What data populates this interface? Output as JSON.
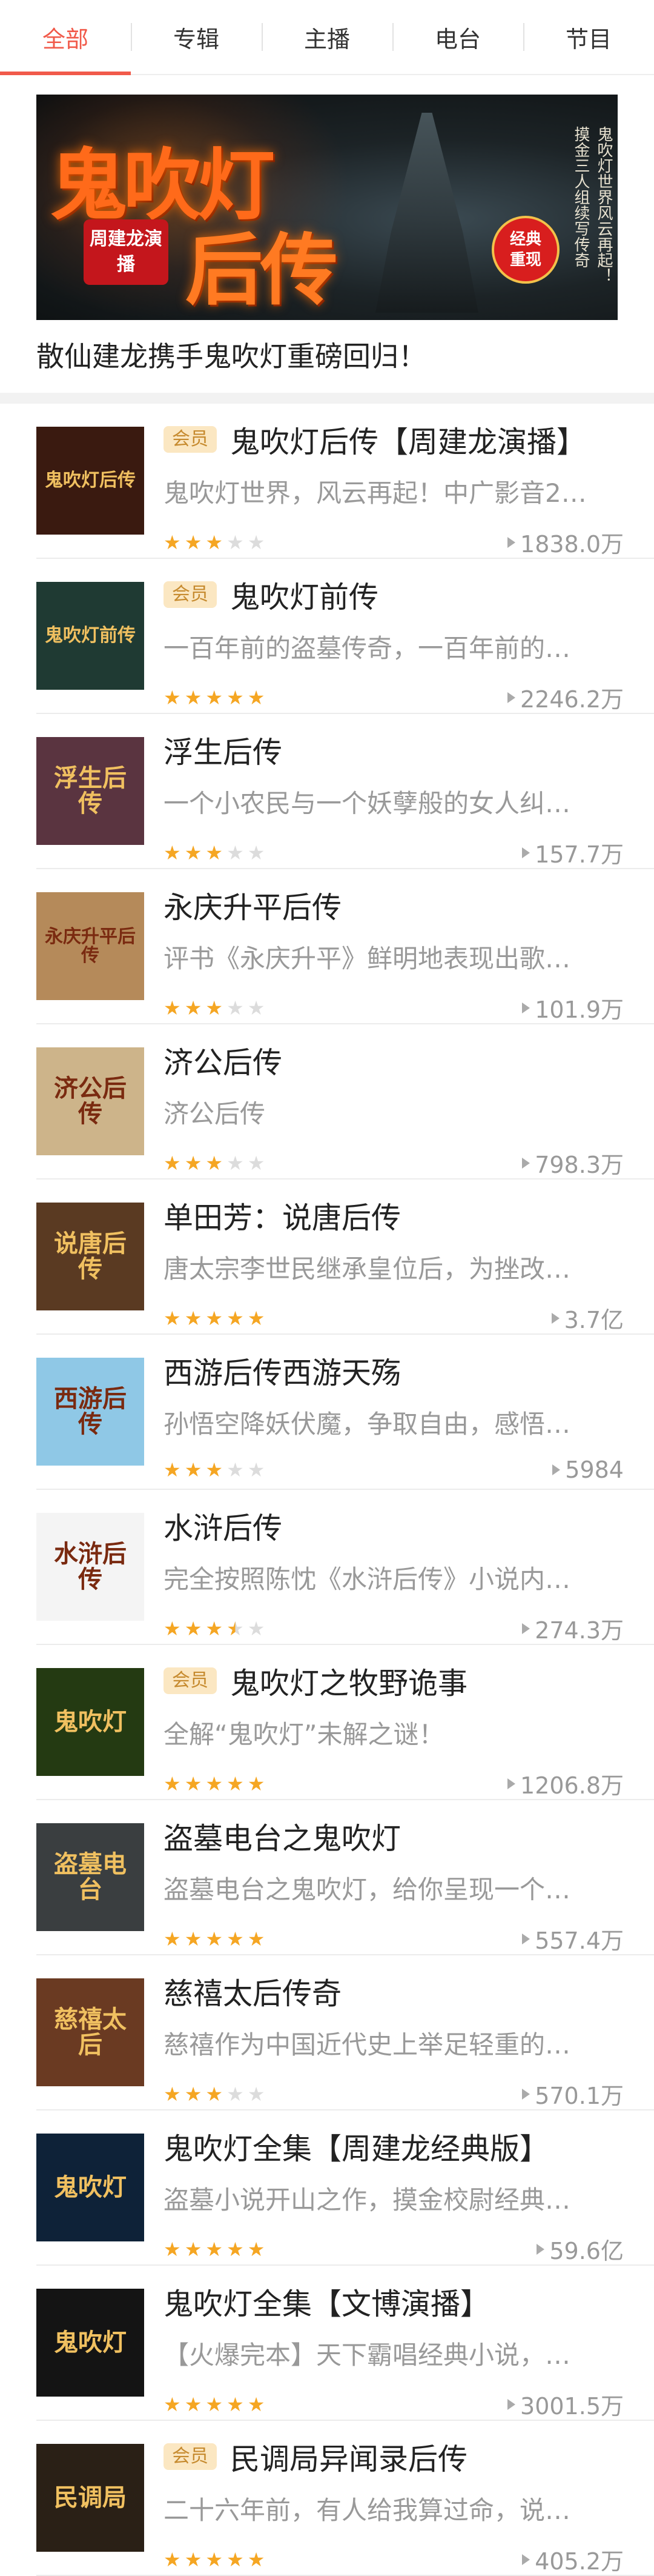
{
  "tabs": [
    {
      "label": "全部",
      "active": true
    },
    {
      "label": "专辑",
      "active": false
    },
    {
      "label": "主播",
      "active": false
    },
    {
      "label": "电台",
      "active": false
    },
    {
      "label": "节目",
      "active": false
    }
  ],
  "accent_color": "#f15a4a",
  "banner": {
    "title_line1": "鬼吹灯",
    "title_line2": "后传",
    "presenter_badge": "周建龙演播",
    "side_text_1": "摸金三人组续写传奇",
    "side_text_2": "鬼吹灯世界风云再起！",
    "classic_badge_1": "经典",
    "classic_badge_2": "重现",
    "caption": "散仙建龙携手鬼吹灯重磅回归！"
  },
  "items": [
    {
      "vip": "会员",
      "title": "鬼吹灯后传【周建龙演播】",
      "desc": "鬼吹灯世界，风云再起！中广影音2…",
      "rating": 3,
      "plays": "1838.0万",
      "cover_text": "鬼吹灯后传",
      "cover_bg": "#3a1a10"
    },
    {
      "vip": "会员",
      "title": "鬼吹灯前传",
      "desc": "一百年前的盗墓传奇，一百年前的…",
      "rating": 5,
      "plays": "2246.2万",
      "cover_text": "鬼吹灯前传",
      "cover_bg": "#1f3a33"
    },
    {
      "vip": "",
      "title": "浮生后传",
      "desc": "一个小农民与一个妖孽般的女人纠…",
      "rating": 3,
      "plays": "157.7万",
      "cover_text": "浮生后传",
      "cover_bg": "#5a3440"
    },
    {
      "vip": "",
      "title": "永庆升平后传",
      "desc": "评书《永庆升平》鲜明地表现出歌…",
      "rating": 3,
      "plays": "101.9万",
      "cover_text": "永庆升平后传",
      "cover_bg": "#b58a5a"
    },
    {
      "vip": "",
      "title": "济公后传",
      "desc": "济公后传",
      "rating": 3,
      "plays": "798.3万",
      "cover_text": "济公后传",
      "cover_bg": "#cdb48a"
    },
    {
      "vip": "",
      "title": "单田芳：说唐后传",
      "desc": "唐太宗李世民继承皇位后，为挫改…",
      "rating": 5,
      "plays": "3.7亿",
      "cover_text": "说唐后传",
      "cover_bg": "#5a3a22"
    },
    {
      "vip": "",
      "title": "西游后传西游天殇",
      "desc": "孙悟空降妖伏魔，争取自由，感悟…",
      "rating": 3,
      "plays": "5984",
      "cover_text": "西游后传",
      "cover_bg": "#8fc8e6"
    },
    {
      "vip": "",
      "title": "水浒后传",
      "desc": "完全按照陈忱《水浒后传》小说内…",
      "rating": 3.5,
      "plays": "274.3万",
      "cover_text": "水浒后传",
      "cover_bg": "#f4f4f4"
    },
    {
      "vip": "会员",
      "title": "鬼吹灯之牧野诡事",
      "desc": "全解“鬼吹灯”未解之谜！",
      "rating": 5,
      "plays": "1206.8万",
      "cover_text": "鬼吹灯",
      "cover_bg": "#243a12"
    },
    {
      "vip": "",
      "title": "盗墓电台之鬼吹灯",
      "desc": "盗墓电台之鬼吹灯，给你呈现一个…",
      "rating": 5,
      "plays": "557.4万",
      "cover_text": "盗墓电台",
      "cover_bg": "#3a3e40"
    },
    {
      "vip": "",
      "title": "慈禧太后传奇",
      "desc": "慈禧作为中国近代史上举足轻重的…",
      "rating": 3,
      "plays": "570.1万",
      "cover_text": "慈禧太后",
      "cover_bg": "#6a3a22"
    },
    {
      "vip": "",
      "title": "鬼吹灯全集【周建龙经典版】",
      "desc": "盗墓小说开山之作，摸金校尉经典…",
      "rating": 5,
      "plays": "59.6亿",
      "cover_text": "鬼吹灯",
      "cover_bg": "#0e2238"
    },
    {
      "vip": "",
      "title": "鬼吹灯全集【文博演播】",
      "desc": "【火爆完本】天下霸唱经典小说，…",
      "rating": 5,
      "plays": "3001.5万",
      "cover_text": "鬼吹灯",
      "cover_bg": "#141414"
    },
    {
      "vip": "会员",
      "title": "民调局异闻录后传",
      "desc": "二十六年前，有人给我算过命，说…",
      "rating": 5,
      "plays": "405.2万",
      "cover_text": "民调局",
      "cover_bg": "#2a2016"
    }
  ]
}
